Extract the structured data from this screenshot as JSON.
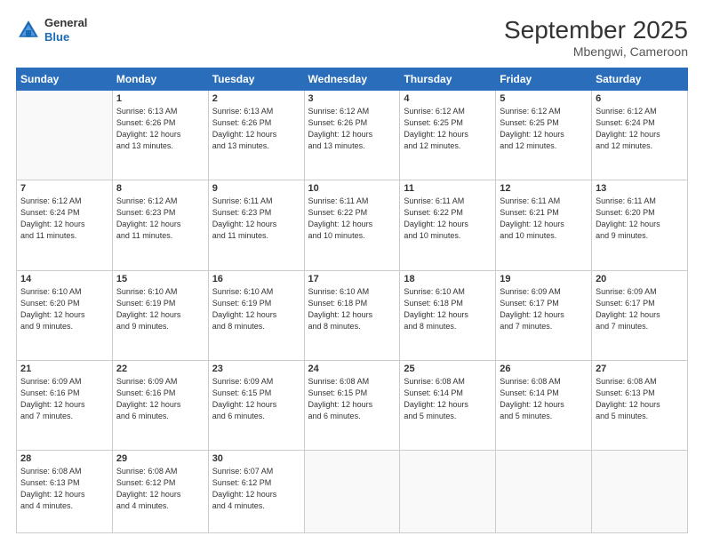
{
  "header": {
    "logo_line1": "General",
    "logo_line2": "Blue",
    "month_title": "September 2025",
    "location": "Mbengwi, Cameroon"
  },
  "days_of_week": [
    "Sunday",
    "Monday",
    "Tuesday",
    "Wednesday",
    "Thursday",
    "Friday",
    "Saturday"
  ],
  "weeks": [
    [
      {
        "day": "",
        "info": ""
      },
      {
        "day": "1",
        "info": "Sunrise: 6:13 AM\nSunset: 6:26 PM\nDaylight: 12 hours\nand 13 minutes."
      },
      {
        "day": "2",
        "info": "Sunrise: 6:13 AM\nSunset: 6:26 PM\nDaylight: 12 hours\nand 13 minutes."
      },
      {
        "day": "3",
        "info": "Sunrise: 6:12 AM\nSunset: 6:26 PM\nDaylight: 12 hours\nand 13 minutes."
      },
      {
        "day": "4",
        "info": "Sunrise: 6:12 AM\nSunset: 6:25 PM\nDaylight: 12 hours\nand 12 minutes."
      },
      {
        "day": "5",
        "info": "Sunrise: 6:12 AM\nSunset: 6:25 PM\nDaylight: 12 hours\nand 12 minutes."
      },
      {
        "day": "6",
        "info": "Sunrise: 6:12 AM\nSunset: 6:24 PM\nDaylight: 12 hours\nand 12 minutes."
      }
    ],
    [
      {
        "day": "7",
        "info": "Sunrise: 6:12 AM\nSunset: 6:24 PM\nDaylight: 12 hours\nand 11 minutes."
      },
      {
        "day": "8",
        "info": "Sunrise: 6:12 AM\nSunset: 6:23 PM\nDaylight: 12 hours\nand 11 minutes."
      },
      {
        "day": "9",
        "info": "Sunrise: 6:11 AM\nSunset: 6:23 PM\nDaylight: 12 hours\nand 11 minutes."
      },
      {
        "day": "10",
        "info": "Sunrise: 6:11 AM\nSunset: 6:22 PM\nDaylight: 12 hours\nand 10 minutes."
      },
      {
        "day": "11",
        "info": "Sunrise: 6:11 AM\nSunset: 6:22 PM\nDaylight: 12 hours\nand 10 minutes."
      },
      {
        "day": "12",
        "info": "Sunrise: 6:11 AM\nSunset: 6:21 PM\nDaylight: 12 hours\nand 10 minutes."
      },
      {
        "day": "13",
        "info": "Sunrise: 6:11 AM\nSunset: 6:20 PM\nDaylight: 12 hours\nand 9 minutes."
      }
    ],
    [
      {
        "day": "14",
        "info": "Sunrise: 6:10 AM\nSunset: 6:20 PM\nDaylight: 12 hours\nand 9 minutes."
      },
      {
        "day": "15",
        "info": "Sunrise: 6:10 AM\nSunset: 6:19 PM\nDaylight: 12 hours\nand 9 minutes."
      },
      {
        "day": "16",
        "info": "Sunrise: 6:10 AM\nSunset: 6:19 PM\nDaylight: 12 hours\nand 8 minutes."
      },
      {
        "day": "17",
        "info": "Sunrise: 6:10 AM\nSunset: 6:18 PM\nDaylight: 12 hours\nand 8 minutes."
      },
      {
        "day": "18",
        "info": "Sunrise: 6:10 AM\nSunset: 6:18 PM\nDaylight: 12 hours\nand 8 minutes."
      },
      {
        "day": "19",
        "info": "Sunrise: 6:09 AM\nSunset: 6:17 PM\nDaylight: 12 hours\nand 7 minutes."
      },
      {
        "day": "20",
        "info": "Sunrise: 6:09 AM\nSunset: 6:17 PM\nDaylight: 12 hours\nand 7 minutes."
      }
    ],
    [
      {
        "day": "21",
        "info": "Sunrise: 6:09 AM\nSunset: 6:16 PM\nDaylight: 12 hours\nand 7 minutes."
      },
      {
        "day": "22",
        "info": "Sunrise: 6:09 AM\nSunset: 6:16 PM\nDaylight: 12 hours\nand 6 minutes."
      },
      {
        "day": "23",
        "info": "Sunrise: 6:09 AM\nSunset: 6:15 PM\nDaylight: 12 hours\nand 6 minutes."
      },
      {
        "day": "24",
        "info": "Sunrise: 6:08 AM\nSunset: 6:15 PM\nDaylight: 12 hours\nand 6 minutes."
      },
      {
        "day": "25",
        "info": "Sunrise: 6:08 AM\nSunset: 6:14 PM\nDaylight: 12 hours\nand 5 minutes."
      },
      {
        "day": "26",
        "info": "Sunrise: 6:08 AM\nSunset: 6:14 PM\nDaylight: 12 hours\nand 5 minutes."
      },
      {
        "day": "27",
        "info": "Sunrise: 6:08 AM\nSunset: 6:13 PM\nDaylight: 12 hours\nand 5 minutes."
      }
    ],
    [
      {
        "day": "28",
        "info": "Sunrise: 6:08 AM\nSunset: 6:13 PM\nDaylight: 12 hours\nand 4 minutes."
      },
      {
        "day": "29",
        "info": "Sunrise: 6:08 AM\nSunset: 6:12 PM\nDaylight: 12 hours\nand 4 minutes."
      },
      {
        "day": "30",
        "info": "Sunrise: 6:07 AM\nSunset: 6:12 PM\nDaylight: 12 hours\nand 4 minutes."
      },
      {
        "day": "",
        "info": ""
      },
      {
        "day": "",
        "info": ""
      },
      {
        "day": "",
        "info": ""
      },
      {
        "day": "",
        "info": ""
      }
    ]
  ]
}
